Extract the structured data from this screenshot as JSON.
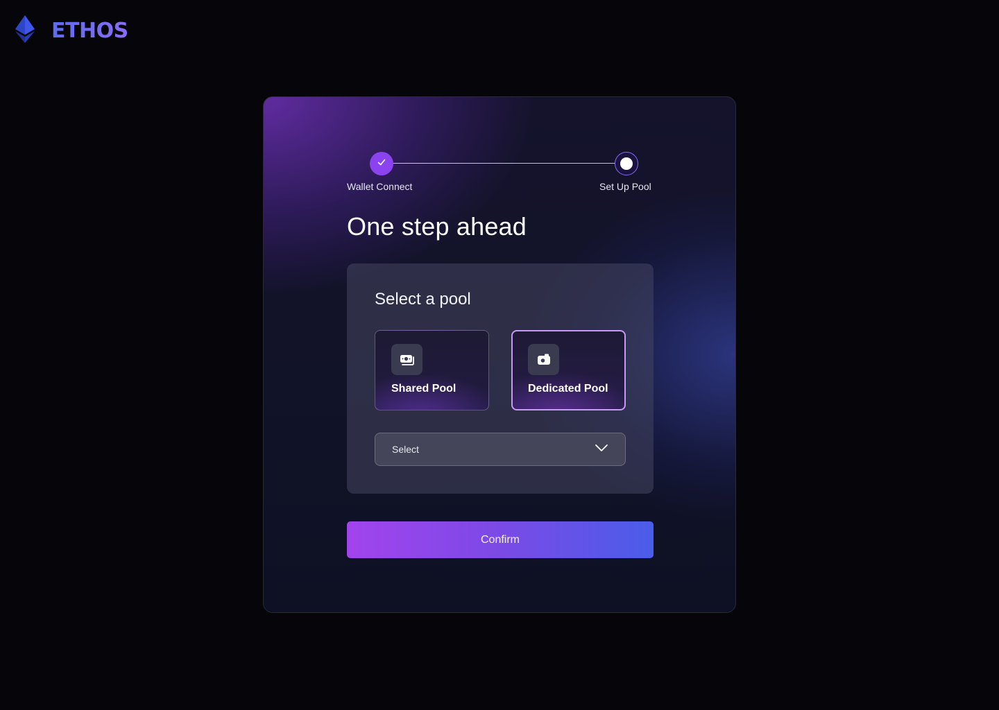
{
  "brand": {
    "name": "ETHOS",
    "logo_icon": "ethereum-diamond-icon"
  },
  "stepper": {
    "steps": [
      {
        "label": "Wallet Connect",
        "status": "completed",
        "icon": "check-icon"
      },
      {
        "label": "Set Up Pool",
        "status": "current"
      }
    ]
  },
  "heading": "One step ahead",
  "pool_selection": {
    "title": "Select a pool",
    "options": [
      {
        "label": "Shared Pool",
        "icon": "shared-pool-icon",
        "selected": false
      },
      {
        "label": "Dedicated Pool",
        "icon": "dedicated-pool-icon",
        "selected": true
      }
    ],
    "dropdown": {
      "value": "Select",
      "icon": "chevron-down-icon"
    }
  },
  "confirm_label": "Confirm",
  "colors": {
    "background": "#05050a",
    "accent_purple": "#8a43ef",
    "accent_blue": "#4a5de9",
    "selected_border": "#c79af7"
  }
}
